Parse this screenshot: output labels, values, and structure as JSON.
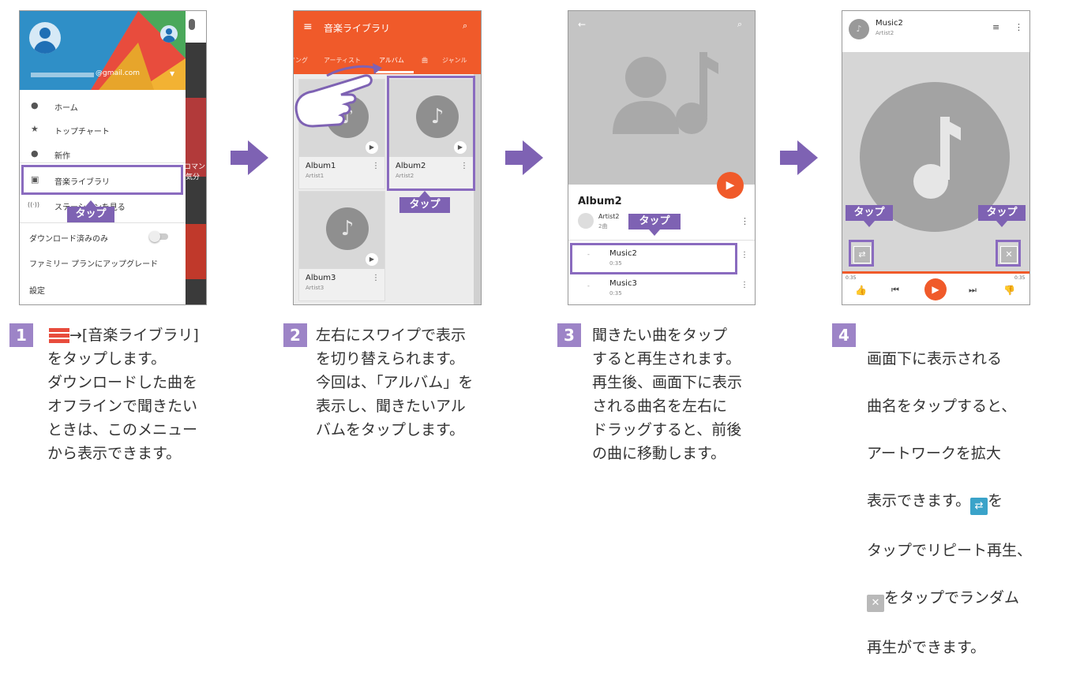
{
  "screens": {
    "s1": {
      "email": "@gmail.com",
      "menu": [
        {
          "label": "ホーム",
          "icon": "home-icon",
          "glyph": "●"
        },
        {
          "label": "トップチャート",
          "icon": "star-icon",
          "glyph": "★"
        },
        {
          "label": "新作",
          "icon": "new-icon",
          "glyph": "●"
        },
        {
          "label": "音楽ライブラリ",
          "icon": "library-icon",
          "glyph": "▣"
        },
        {
          "label": "ステーションを見る",
          "icon": "radio-icon",
          "glyph": "((·))"
        }
      ],
      "download_only": "ダウンロード済みのみ",
      "upgrade": "ファミリー プランにアップグレード",
      "settings": "設定",
      "behind_text_1": "コマン",
      "behind_text_2": "気分",
      "tap": "タップ"
    },
    "s2": {
      "title": "音楽ライブラリ",
      "tabs": [
        "ソング",
        "アーティスト",
        "アルバム",
        "曲",
        "ジャンル"
      ],
      "albums": [
        {
          "name": "Album1",
          "artist": "Artist1"
        },
        {
          "name": "Album2",
          "artist": "Artist2"
        },
        {
          "name": "Album3",
          "artist": "Artist3"
        }
      ],
      "tap": "タップ"
    },
    "s3": {
      "album": "Album2",
      "artist": "Artist2",
      "count": "2曲",
      "songs": [
        {
          "title": "Music2",
          "time": "0:35"
        },
        {
          "title": "Music3",
          "time": "0:35"
        }
      ],
      "tap": "タップ"
    },
    "s4": {
      "song": "Music2",
      "artist": "Artist2",
      "time_left": "0:35",
      "time_right": "0:35",
      "tap_left": "タップ",
      "tap_right": "タップ"
    }
  },
  "steps": [
    {
      "num": "1",
      "text": "→[音楽ライブラリ]\nをタップします。\nダウンロードした曲を\nオフラインで聞きたい\nときは、このメニュー\nから表示できます。"
    },
    {
      "num": "2",
      "text": "左右にスワイプで表示\nを切り替えられます。\n今回は、「アルバム」を\n表示し、聞きたいアル\nバムをタップします。"
    },
    {
      "num": "3",
      "text": "聞きたい曲をタップ\nすると再生されます。\n再生後、画面下に表示\nされる曲名を左右に\nドラッグすると、前後\nの曲に移動します。"
    },
    {
      "num": "4",
      "line1": "画面下に表示される",
      "line2": "曲名をタップすると、",
      "line3": "アートワークを拡大",
      "line4a": "表示できます。",
      "line4b": "を",
      "line5": "タップでリピート再生、",
      "line6b": "をタップでランダム",
      "line7": "再生ができます。"
    }
  ],
  "colors": {
    "accent": "#7e62b3",
    "orange": "#f05a2a",
    "number_bg": "#9d84c7"
  }
}
